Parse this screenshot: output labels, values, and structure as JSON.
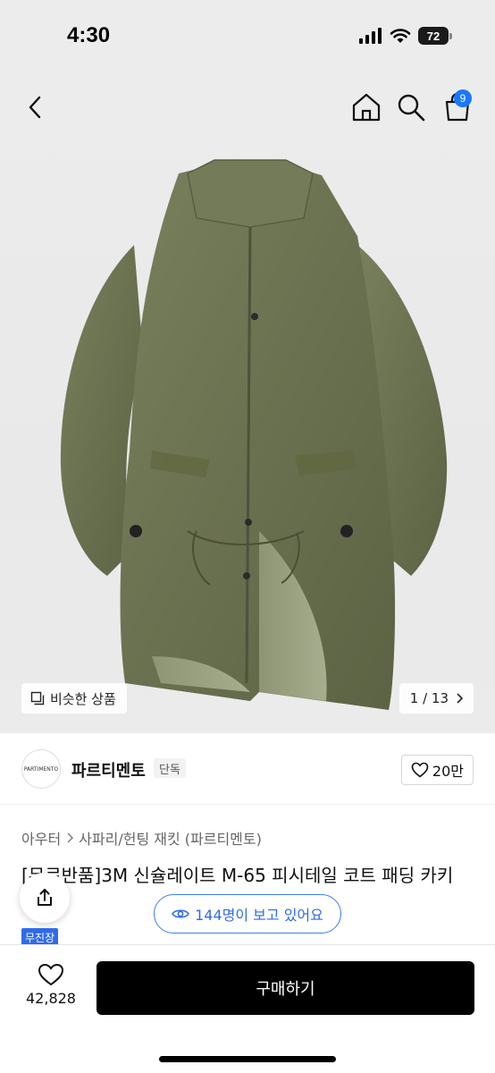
{
  "status_bar": {
    "time": "4:30",
    "battery": "72",
    "icons": [
      "cellular-signal-icon",
      "wifi-icon",
      "battery-icon"
    ]
  },
  "nav": {
    "icons": [
      "back-chevron-icon",
      "home-icon",
      "search-icon",
      "cart-icon"
    ],
    "cart_count": "9"
  },
  "hero": {
    "image_subject": "olive green M-65 fishtail parka",
    "similar_label": "비슷한 상품",
    "page_indicator": "1 / 13"
  },
  "brand": {
    "logo_text": "PARTIMENTO",
    "name": "파르티멘토",
    "tag": "단독",
    "likes": "20만"
  },
  "product": {
    "breadcrumb": [
      "아우터",
      "사파리/헌팅 재킷 (파르티멘토)"
    ],
    "title": "[무료반품]3M 신슐레이트 M-65 피시테일 코트 패딩 카키",
    "viewers": "144명이 보고 있어요",
    "badge": "무진장"
  },
  "bottom_bar": {
    "wish_count": "42,828",
    "buy_label": "구매하기"
  },
  "colors": {
    "accent_blue": "#2f6bea",
    "badge_blue": "#1a78ff",
    "buy_button": "#000000",
    "coat_olive": "#6b7250"
  }
}
